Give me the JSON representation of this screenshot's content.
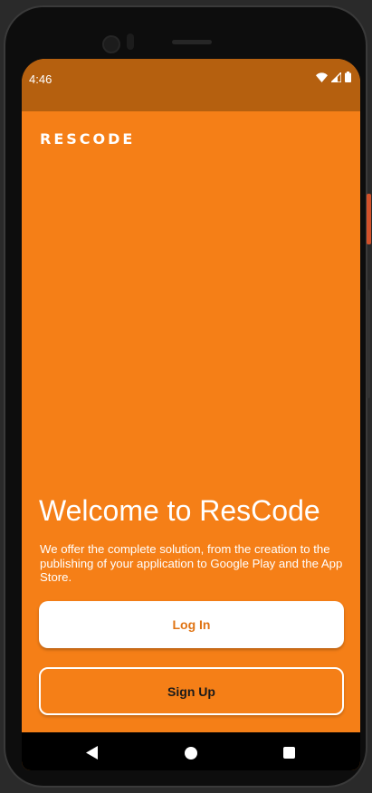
{
  "status_bar": {
    "time": "4:46",
    "icons": [
      "wifi-icon",
      "cell-signal-icon",
      "battery-icon"
    ]
  },
  "app": {
    "brand": "RESCODE",
    "welcome_title": "Welcome to ResCode",
    "description": "We offer the complete solution, from the creation to the publishing of your application to Google Play and the App Store.",
    "login_label": "Log In",
    "signup_label": "Sign Up"
  },
  "navigation": {
    "icons": [
      "back-icon",
      "home-icon",
      "recents-icon"
    ]
  },
  "colors": {
    "primary": "#f57f17",
    "status_bar": "#b5600f",
    "login_text": "#e07414",
    "button_bg": "#ffffff"
  }
}
